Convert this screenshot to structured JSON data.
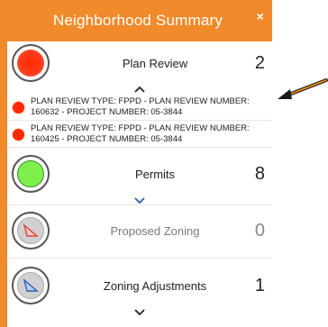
{
  "panel": {
    "title": "Neighborhood Summary",
    "close_label": "×",
    "accent_color": "#f08a2a"
  },
  "sections": [
    {
      "label": "Plan Review",
      "count": "2",
      "symbol": "red-circle-icon",
      "expanded": true
    },
    {
      "label": "Permits",
      "count": "8",
      "symbol": "green-circle-icon",
      "expanded": false
    },
    {
      "label": "Proposed Zoning",
      "count": "0",
      "symbol": "zoning-polygon-icon",
      "expanded": false
    },
    {
      "label": "Zoning Adjustments",
      "count": "1",
      "symbol": "zoning-polygon-icon",
      "expanded": false
    }
  ],
  "plan_review_items": [
    {
      "text": "PLAN REVIEW TYPE: FPPD - PLAN REVIEW NUMBER: 160632 - PROJECT NUMBER: 05-3844"
    },
    {
      "text": "PLAN REVIEW TYPE: FPPD - PLAN REVIEW NUMBER: 160425 - PROJECT NUMBER: 05-3844"
    }
  ]
}
